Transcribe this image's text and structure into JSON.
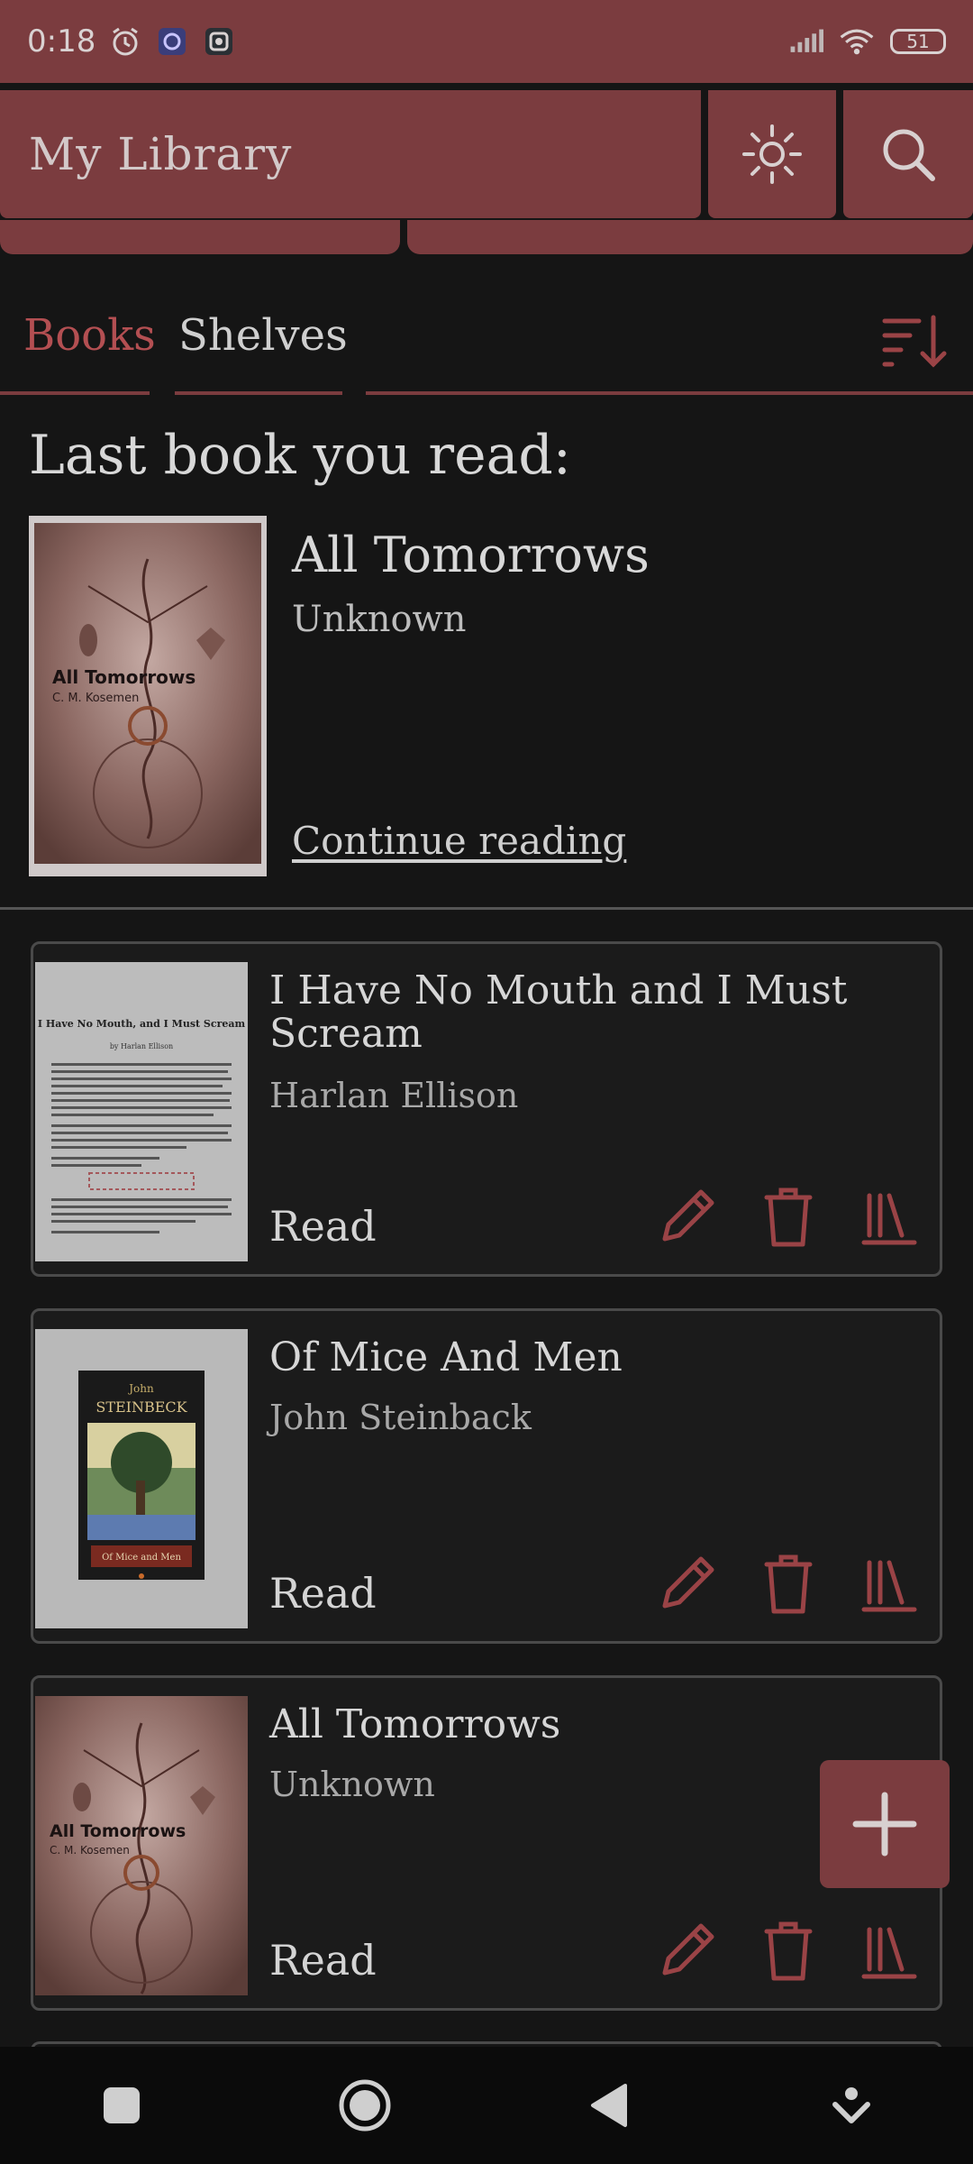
{
  "status": {
    "time": "0:18",
    "battery": "51"
  },
  "appbar": {
    "title": "My Library"
  },
  "tabs": [
    {
      "label": "Books",
      "active": true
    },
    {
      "label": "Shelves",
      "active": false
    }
  ],
  "last_read": {
    "heading": "Last book you read:",
    "title": "All Tomorrows",
    "author": "Unknown",
    "continue_label": "Continue reading",
    "cover_title": "All Tomorrows",
    "cover_author": "C. M. Kosemen"
  },
  "books": [
    {
      "title": "I Have No Mouth and I Must Scream",
      "author": "Harlan Ellison",
      "read_label": "Read",
      "cover_title": "I Have No Mouth, and I Must Scream",
      "cover_author": "by Harlan Ellison"
    },
    {
      "title": "Of Mice And Men",
      "author": "John Steinback",
      "read_label": "Read",
      "cover_author": "John",
      "cover_name": "STEINBECK",
      "cover_title": "Of Mice and Men"
    },
    {
      "title": "All Tomorrows",
      "author": "Unknown",
      "read_label": "Read",
      "cover_title": "All Tomorrows",
      "cover_author": "C. M. Kosemen"
    }
  ],
  "colors": {
    "accent": "#7b3c3f",
    "accent_text": "#b34f52",
    "background": "#151515"
  }
}
